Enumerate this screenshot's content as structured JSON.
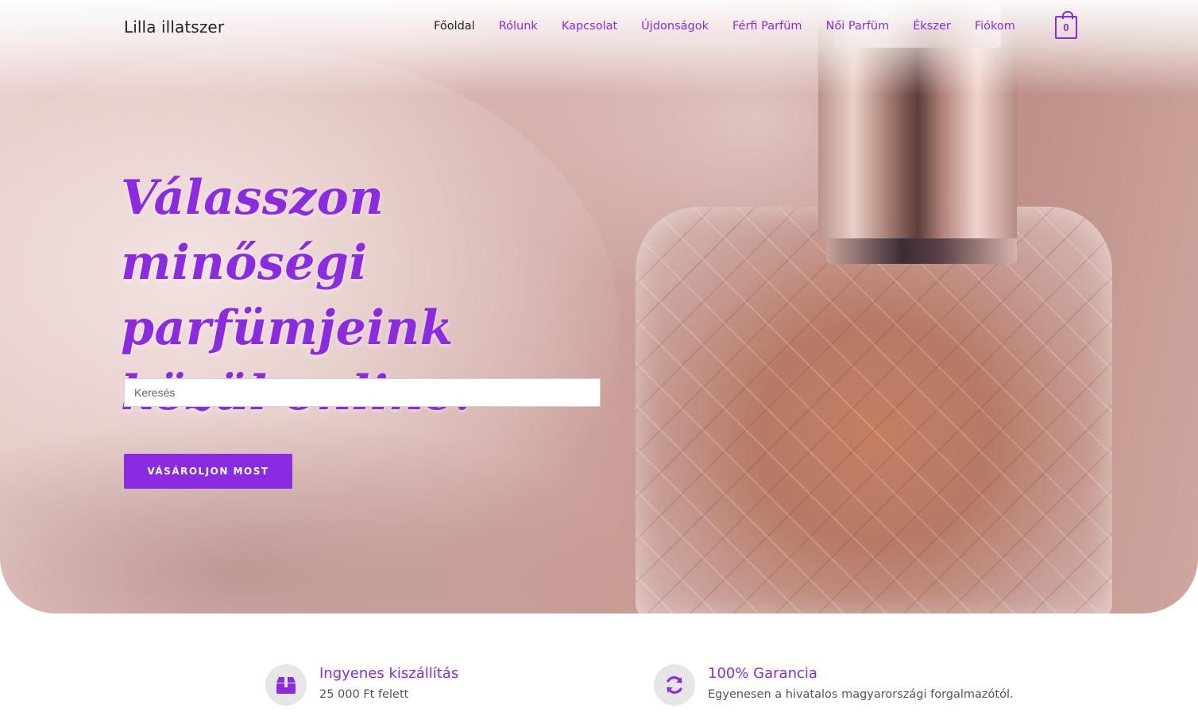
{
  "header": {
    "logo": "Lilla illatszer",
    "nav": [
      "Főoldal",
      "Rólunk",
      "Kapcsolat",
      "Újdonságok",
      "Férfi Parfüm",
      "Női Parfüm",
      "Ékszer",
      "Fiókom"
    ],
    "active_nav": "Főoldal",
    "cart_count": "0"
  },
  "hero": {
    "headline": "Válasszon minőségi parfümjeink közül online.",
    "search": {
      "placeholder": "Keresés",
      "value": ""
    },
    "cta_label": "VÁSÁROLJON MOST"
  },
  "features": [
    {
      "icon": "box-icon",
      "title": "Ingyenes kiszállítás",
      "subtitle": "25 000 Ft felett"
    },
    {
      "icon": "refresh-icon",
      "title": "100% Garancia",
      "subtitle": "Egyenesen a hivatalos magyarországi forgalmazótól."
    }
  ],
  "colors": {
    "accent": "#8a2be2",
    "text_dark": "#222222",
    "icon_bg": "#e6e6e6"
  }
}
